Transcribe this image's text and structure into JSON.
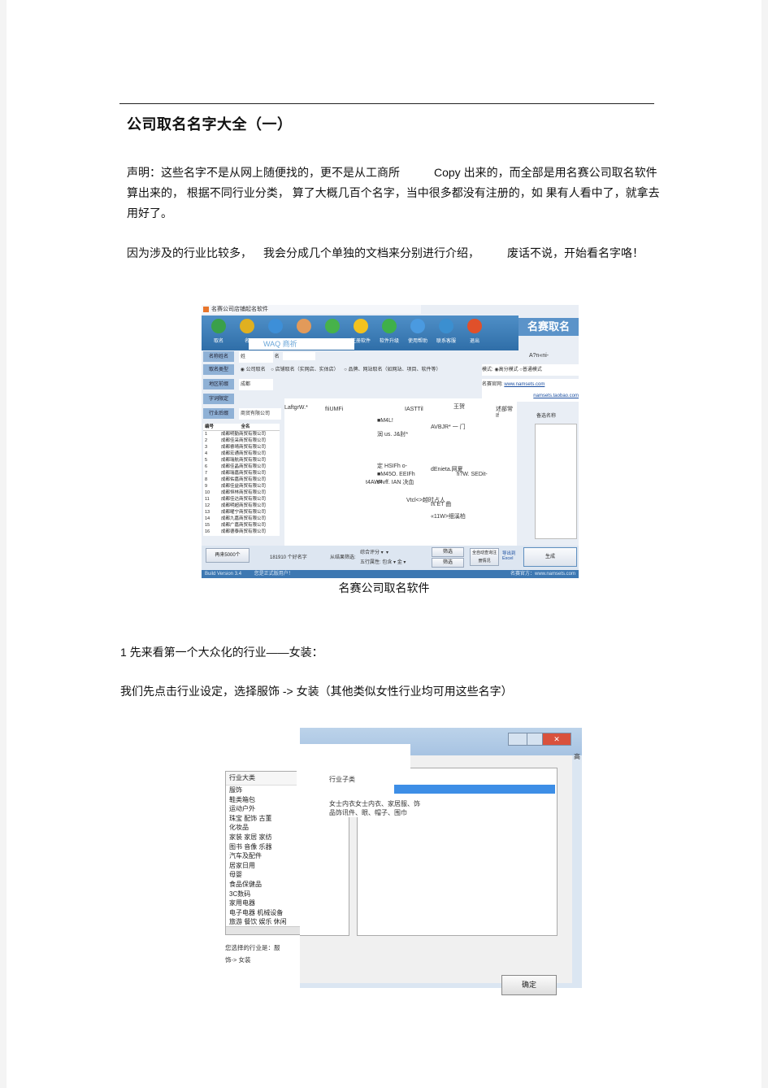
{
  "document": {
    "title": "公司取名名字大全（一）",
    "paragraph1_a": "声明：这些名字不是从网上随便找的，更不是从工商所",
    "paragraph1_b": "Copy 出来的，而全部是用名赛公司取名软件算出来的， 根据不同行业分类， 算了大概几百个名字，当中很多都没有注册的，如 果有人看中了，就拿去用好了。",
    "paragraph2_a": "因为涉及的行业比较多，",
    "paragraph2_b": "我会分成几个单独的文档来分别进行介绍，",
    "paragraph2_c": "废话不说，开始看名字咯！",
    "figure1_caption": "名赛公司取名软件",
    "section1_heading": "1 先来看第一个大众化的行业——女装：",
    "section1_text": "我们先点击行业设定，选择服饰 -> 女装（其他类似女性行业均可用这些名字）"
  },
  "figure1": {
    "window_title": "名赛公司店铺起名软件",
    "toolbar": [
      {
        "label": "取名",
        "icon": "box-icon",
        "color": "#3aa04a"
      },
      {
        "label": "名",
        "icon": "user-icon",
        "color": "#e0b020"
      },
      {
        "label": "",
        "icon": "info-icon",
        "color": "#3d8fd8"
      },
      {
        "label": "",
        "icon": "people-icon",
        "color": "#e29a5a"
      },
      {
        "label": "",
        "icon": "plus-icon",
        "color": "#47b24a"
      },
      {
        "label": "注册软件",
        "icon": "sun-icon",
        "color": "#f3c21e"
      },
      {
        "label": "软件升级",
        "icon": "up-arrow-icon",
        "color": "#3fb04a"
      },
      {
        "label": "使用帮助",
        "icon": "help-icon",
        "color": "#4a9ae0"
      },
      {
        "label": "联系客服",
        "icon": "globe-icon",
        "color": "#3b8fd0"
      },
      {
        "label": "退出",
        "icon": "exit-icon",
        "color": "#e0502a"
      }
    ],
    "logo": "名赛取名",
    "waq_text": "WAQ 商祈",
    "fields": {
      "surname_label": "名称姓名",
      "surname_value": "姓",
      "name_label": "名",
      "type_label": "取名类型",
      "type_opt1": "公司取名",
      "type_opt2": "店铺取名（实网店、实体店）",
      "type_opt3": "品牌、网站取名（如网站、项目、软件等）",
      "region_label": "地区前缀",
      "region_value": "成都",
      "word_label": "字词限定",
      "industry_label": "行业后缀",
      "industry_value": "商贸有限公司",
      "mode_label": "模式:",
      "mode_opt1": "高分模式",
      "mode_opt2": "普通模式",
      "site_label": "名赛官网:",
      "site_url": "www.namsets.com",
      "site_url2": "namsets.taobao.com",
      "backup_label": "备选名称",
      "month_label": "月",
      "ocr_top": "A?n«ni-"
    },
    "ocr_fragments": [
      "fIiUMFi",
      "IASTTil",
      "LaftgrW.*",
      "王贺",
      "述部常 If",
      "■M4L!",
      "润 us. J&肘*",
      "定 HSIFh o-",
      "■M45O. EEIFh",
      "tPvff. IAN 决血",
      "Vtcl<>越时占人",
      "ℝ ET 曲",
      "«11W>细溪柏",
      "AVBJR*  一 门",
      "dEnieta.网夏",
      "fi?W. SEDit-",
      "t4AW4"
    ],
    "list_headers": [
      "编号",
      "全名"
    ],
    "list_rows": [
      "成都明勤商贸有限公司",
      "成都佳采商贸有限公司",
      "成都睿晴商贸有限公司",
      "成都宏通商贸有限公司",
      "成都瑞航商贸有限公司",
      "成都佳晶商贸有限公司",
      "成都瑞嘉商贸有限公司",
      "成都佑嘉商贸有限公司",
      "成都佳益商贸有限公司",
      "成都恒林商贸有限公司",
      "成都佳达商贸有限公司",
      "成都明超商贸有限公司",
      "成都曜宁商贸有限公司",
      "成都九嘉商贸有限公司",
      "成都广嘉商贸有限公司",
      "成都德泰商贸有限公司"
    ],
    "bottom": {
      "generate_count_button": "再来5000个",
      "count_text": "181910 个好名字",
      "filter_label": "从结果筛选:",
      "filter1": "综合评分",
      "filter2_label": "五行属性:",
      "filter2": "包含",
      "filter3": "金",
      "filter_button": "筛选",
      "filter_button2": "筛选",
      "check_button": "全自动查询注册情况",
      "export_button": "导出到Excel",
      "generate_button": "生成"
    },
    "status": {
      "version": "Build Version 3.4",
      "user": "您是正式版用户！",
      "site": "名赛官方：www.namsets.com"
    }
  },
  "figure2": {
    "industry_header": "行业大类",
    "industries": [
      "服饰",
      "鞋类箱包",
      "运动户外",
      "珠宝 配饰 古董",
      "化妆品",
      "家装 家居 家纺",
      "图书 音像 乐器",
      "汽车及配件",
      "居家日用",
      "母婴",
      "食品保健品",
      "3C数码",
      "家用电器",
      "电子电器 机械设备",
      "旅游 餐饮 娱乐 休闲"
    ],
    "selected_note": "您选择的行业是：服饰-> 女装",
    "subcategory_header": "行业子类",
    "subcategory_desc": "女士内衣女士内衣、家居服、饰品饰讯件、眼、帽子、围巾",
    "ok_button": "确定",
    "side_char": "高"
  }
}
